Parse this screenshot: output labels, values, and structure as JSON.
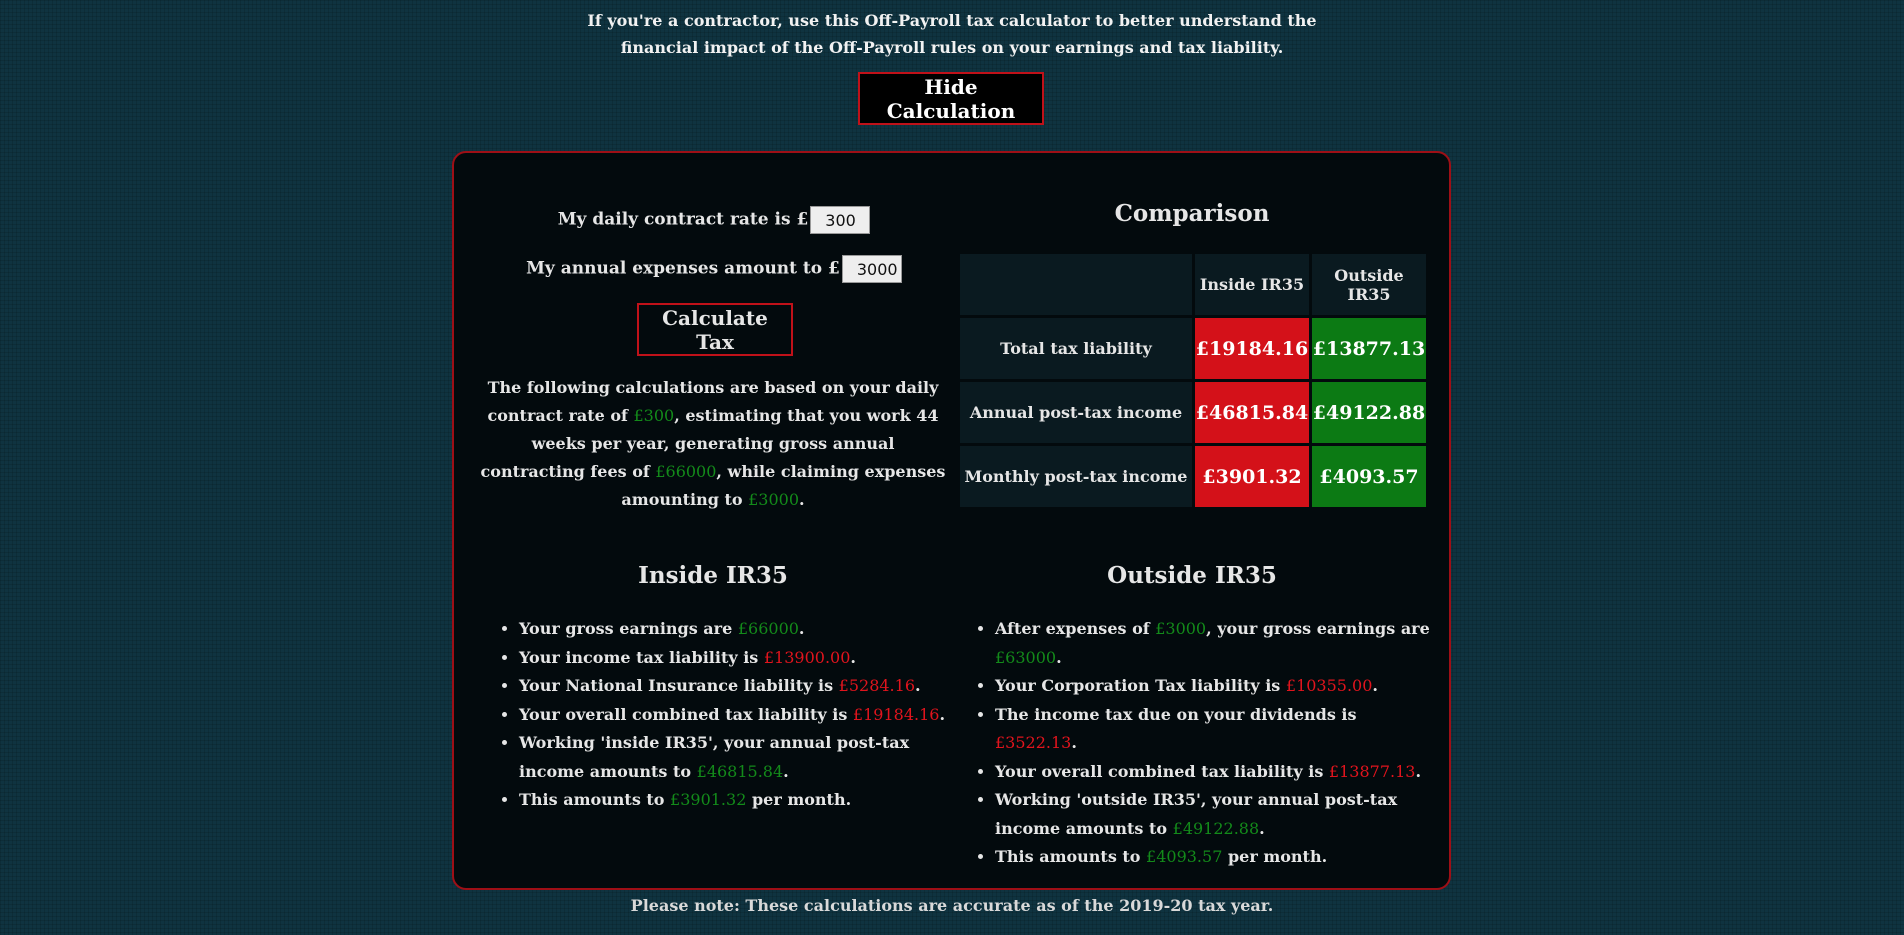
{
  "intro": {
    "line1": "If you're a contractor, use this Off-Payroll tax calculator to better understand the",
    "line2": "financial impact of the Off-Payroll rules on your earnings and tax liability."
  },
  "hide_button": "Hide Calculation",
  "form": {
    "daily_rate_label": "My daily contract rate is £",
    "daily_rate_value": "300",
    "expenses_label": "My annual expenses amount to £",
    "expenses_value": "3000",
    "calculate_button": "Calculate Tax"
  },
  "summary": {
    "t1": "The following calculations are based on your daily contract rate of ",
    "rate": "£300",
    "t2": ", estimating that you work 44 weeks per year, generating gross annual contracting fees of ",
    "fees": "£66000",
    "t3": ", while claiming expenses amounting to ",
    "expenses": "£3000",
    "t4": "."
  },
  "comparison": {
    "title": "Comparison",
    "headers": [
      "",
      "Inside IR35",
      "Outside IR35"
    ],
    "rows": [
      {
        "label": "Total tax liability",
        "inside": "£19184.16",
        "outside": "£13877.13"
      },
      {
        "label": "Annual post-tax income",
        "inside": "£46815.84",
        "outside": "£49122.88"
      },
      {
        "label": "Monthly post-tax income",
        "inside": "£3901.32",
        "outside": "£4093.57"
      }
    ]
  },
  "inside": {
    "title": "Inside IR35",
    "items": [
      {
        "pre": "Your gross earnings are ",
        "val": "£66000",
        "post": "."
      },
      {
        "pre": "Your income tax liability is ",
        "val": "£13900.00",
        "post": "."
      },
      {
        "pre": "Your National Insurance liability is ",
        "val": "£5284.16",
        "post": "."
      },
      {
        "pre": "Your overall combined tax liability is ",
        "val": "£19184.16",
        "post": "."
      },
      {
        "pre": "Working 'inside IR35', your annual post-tax income amounts to ",
        "val": "£46815.84",
        "post": "."
      },
      {
        "pre": "This amounts to ",
        "val": "£3901.32",
        "post": " per month."
      }
    ]
  },
  "outside": {
    "title": "Outside IR35",
    "items": [
      {
        "pre": "After expenses of ",
        "val": "£3000",
        "mid": ", your gross earnings are ",
        "val2": "£63000",
        "post": "."
      },
      {
        "pre": "Your Corporation Tax liability is ",
        "val": "£10355.00",
        "post": "."
      },
      {
        "pre": "The income tax due on your dividends is ",
        "val": "£3522.13",
        "post": "."
      },
      {
        "pre": "Your overall combined tax liability is ",
        "val": "£13877.13",
        "post": "."
      },
      {
        "pre": "Working 'outside IR35', your annual post-tax income amounts to ",
        "val": "£49122.88",
        "post": "."
      },
      {
        "pre": "This amounts to ",
        "val": "£4093.57",
        "post": " per month."
      }
    ]
  },
  "note": "Please note: These calculations are accurate as of the 2019-20 tax year.",
  "colors": {
    "background": "#0f3340",
    "panel": "#030a0d",
    "accent_red": "#c01119",
    "value_green": "#138a1a",
    "value_red": "#e0141d",
    "cell_red": "#d41119",
    "cell_green": "#0c7a14"
  }
}
